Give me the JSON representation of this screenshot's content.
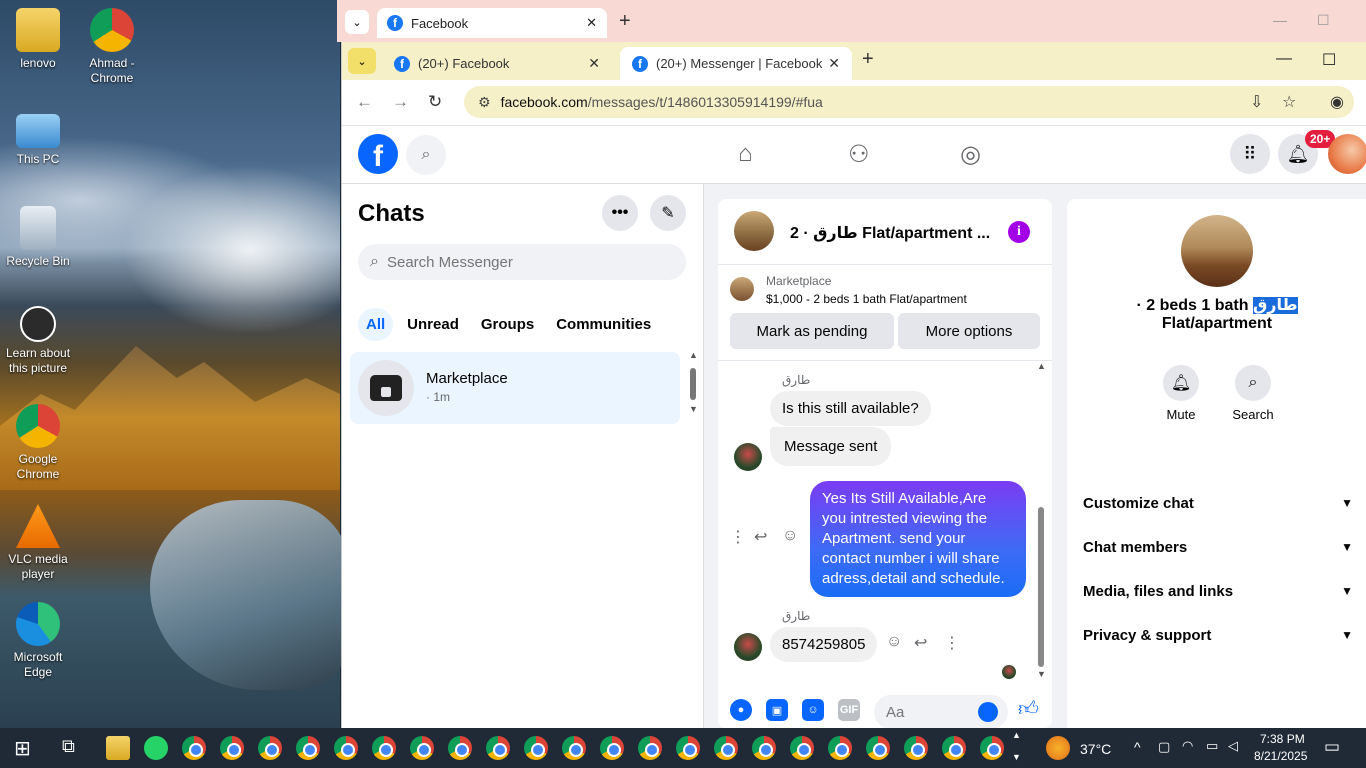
{
  "desktop": {
    "icons": [
      {
        "label": "lenovo",
        "icon": "folder-user-icon"
      },
      {
        "label": "Ahmad - Chrome",
        "icon": "chrome-icon"
      },
      {
        "label": "This PC",
        "icon": "computer-icon"
      },
      {
        "label": "Recycle Bin",
        "icon": "recycle-bin-icon"
      },
      {
        "label": "Learn about this picture",
        "icon": "info-camera-icon"
      },
      {
        "label": "Google Chrome",
        "icon": "chrome-icon"
      },
      {
        "label": "VLC media player",
        "icon": "vlc-icon"
      },
      {
        "label": "Microsoft Edge",
        "icon": "edge-icon"
      }
    ]
  },
  "back_window": {
    "tab_title": "Facebook"
  },
  "browser": {
    "tabs": [
      {
        "title": "(20+) Facebook",
        "active": false
      },
      {
        "title": "(20+) Messenger | Facebook",
        "active": true
      }
    ],
    "url_host": "facebook.com",
    "url_path": "/messages/t/1486013305914199/#fua"
  },
  "fb": {
    "notification_badge": "20+"
  },
  "chats": {
    "title": "Chats",
    "search_placeholder": "Search Messenger",
    "filters": [
      "All",
      "Unread",
      "Groups",
      "Communities"
    ],
    "conversations": [
      {
        "name": "Marketplace",
        "time": "· 1m"
      }
    ]
  },
  "conversation": {
    "header_title": "طارق · 2 Flat/apartment ...",
    "listing_source": "Marketplace",
    "listing_desc": "$1,000 - 2 beds 1 bath Flat/apartment",
    "btn_pending": "Mark as pending",
    "btn_more": "More options",
    "messages": [
      {
        "sender": "طارق",
        "text": "Is this still available?"
      },
      {
        "text": "Message sent"
      },
      {
        "text": "Yes Its Still Available,Are you intrested viewing the Apartment. send your contact number i will share adress,detail and schedule."
      },
      {
        "sender": "طارق",
        "text": "8574259805"
      }
    ],
    "composer_placeholder": "Aa"
  },
  "info": {
    "name_highlight": "طارق",
    "name_rest": " · 2 beds 1 bath",
    "name_line2": "Flat/apartment",
    "actions": [
      {
        "label": "Mute"
      },
      {
        "label": "Search"
      }
    ],
    "sections": [
      "Customize chat",
      "Chat members",
      "Media, files and links",
      "Privacy & support"
    ]
  },
  "taskbar": {
    "temperature": "37°C",
    "time": "7:38 PM",
    "date": "8/21/2025"
  },
  "colors": {
    "fb_blue": "#0866ff",
    "outgoing_bubble_top": "#7b3cf3",
    "outgoing_bubble_bottom": "#1a6cf6",
    "notification_red": "#e41e3f"
  }
}
